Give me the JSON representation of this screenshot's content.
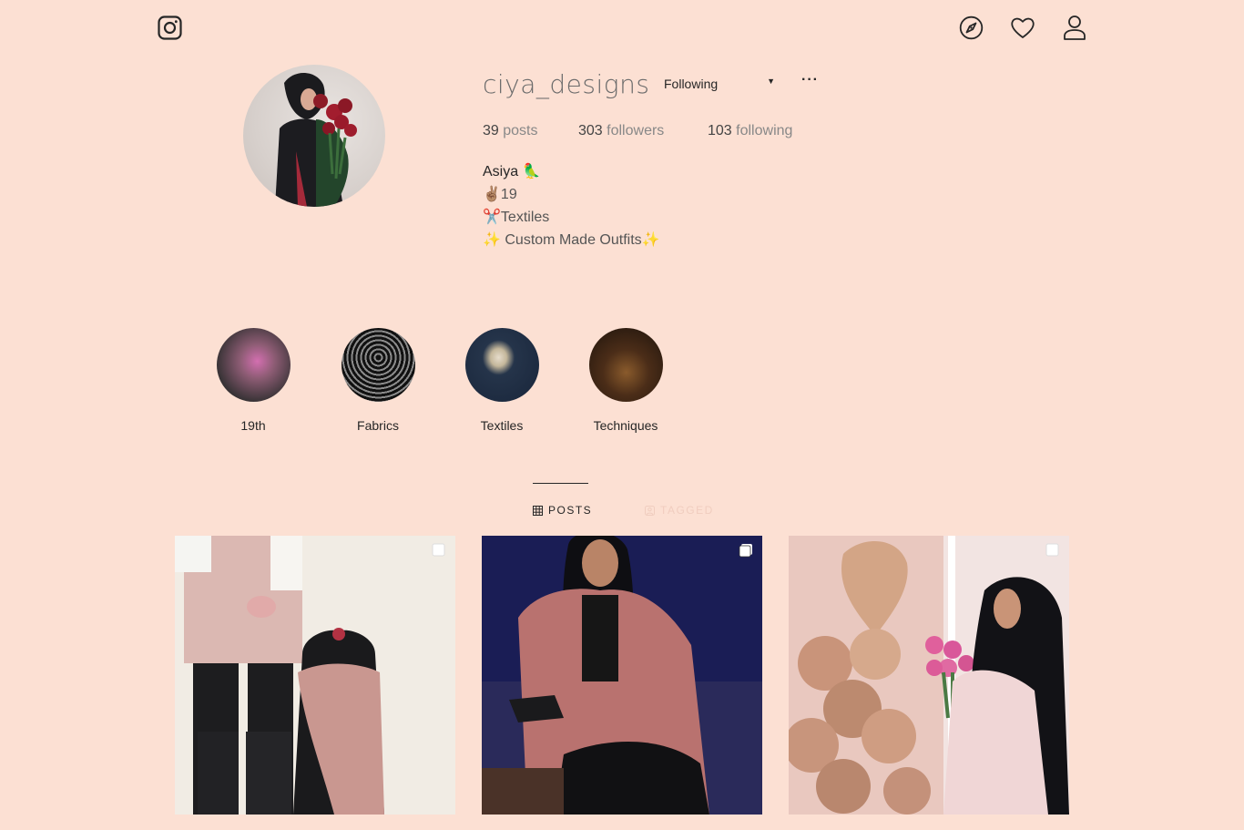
{
  "header": {
    "logo_icon": "instagram-icon",
    "nav_icons": [
      "compass-icon",
      "heart-icon",
      "user-icon"
    ]
  },
  "profile": {
    "username": "ciya_designs",
    "follow_state": "Following",
    "more_label": "···",
    "stats": {
      "posts_count": "39",
      "posts_label": "posts",
      "followers_count": "303",
      "followers_label": "followers",
      "following_count": "103",
      "following_label": "following"
    },
    "bio": {
      "name": "Asiya 🦜",
      "line1": "✌🏽19",
      "line2": "✂️Textiles",
      "line3": "✨ Custom Made Outfits✨"
    }
  },
  "highlights": [
    {
      "label": "19th"
    },
    {
      "label": "Fabrics"
    },
    {
      "label": "Textiles"
    },
    {
      "label": "Techniques"
    }
  ],
  "tabs": {
    "posts": "POSTS",
    "tagged": "TAGGED"
  },
  "colors": {
    "background": "#fce0d3",
    "text": "#262626",
    "muted": "#888888",
    "tagged_tab": "#f0cdbf"
  }
}
